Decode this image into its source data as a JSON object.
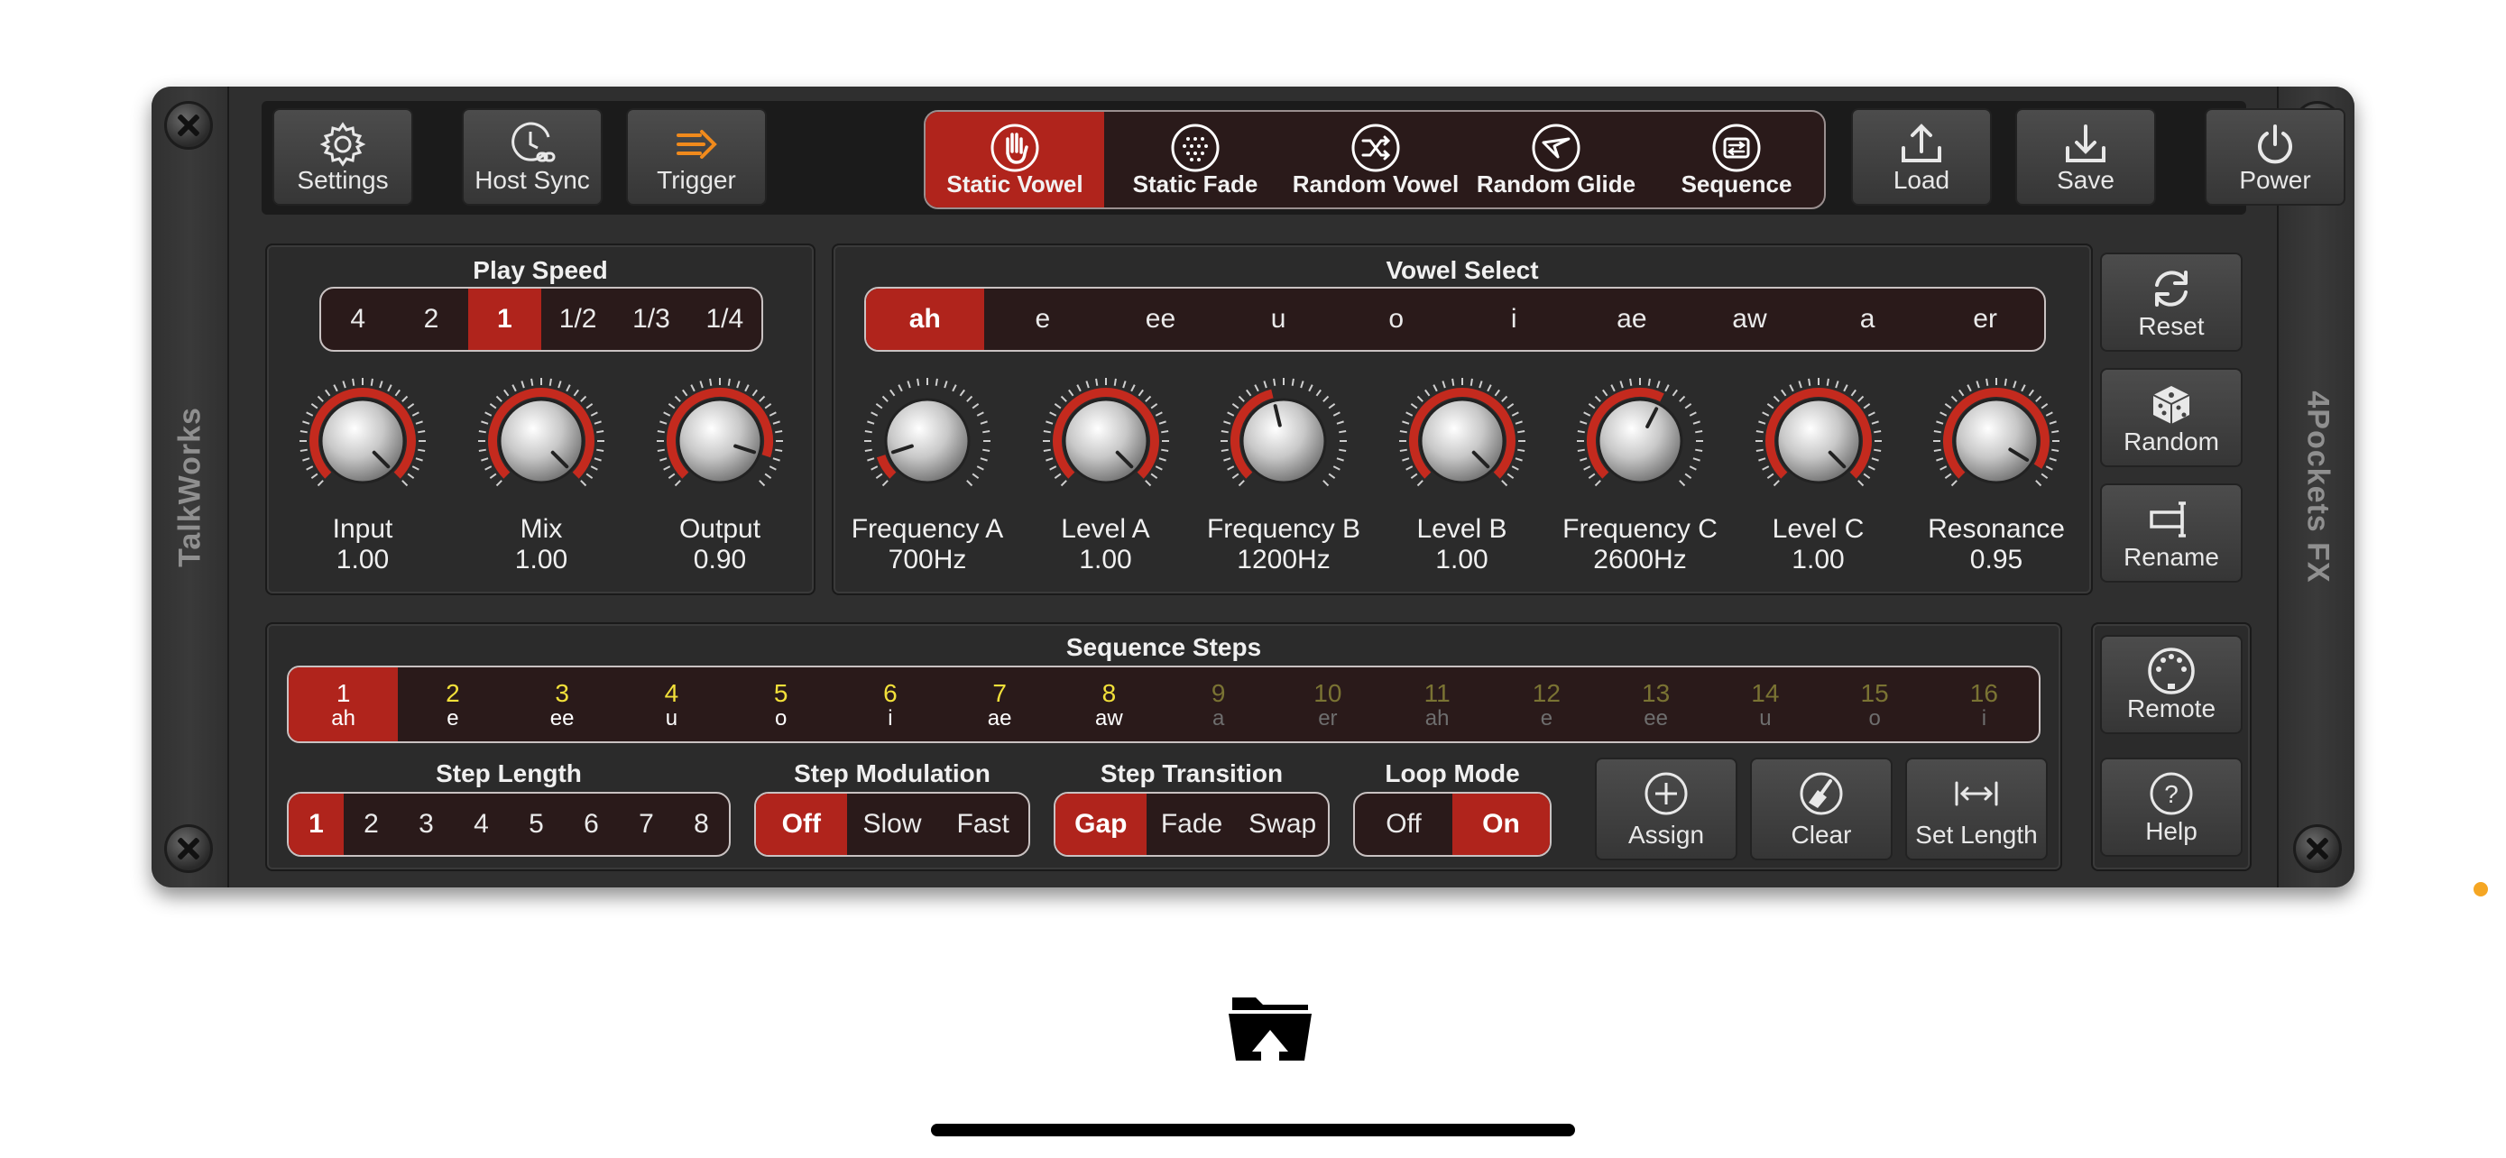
{
  "brand_left": "TalkWorks",
  "brand_right": "4Pockets FX",
  "topbar": {
    "settings": "Settings",
    "host_sync": "Host Sync",
    "trigger": "Trigger",
    "modes": [
      "Static Vowel",
      "Static Fade",
      "Random Vowel",
      "Random Glide",
      "Sequence"
    ],
    "active_mode": 0,
    "load": "Load",
    "save": "Save",
    "power": "Power"
  },
  "play_speed": {
    "title": "Play Speed",
    "options": [
      "4",
      "2",
      "1",
      "1/2",
      "1/3",
      "1/4"
    ],
    "selected": 2,
    "knobs": [
      {
        "label": "Input",
        "value": "1.00",
        "level": 1.0
      },
      {
        "label": "Mix",
        "value": "1.00",
        "level": 1.0
      },
      {
        "label": "Output",
        "value": "0.90",
        "level": 0.9
      }
    ]
  },
  "vowel_select": {
    "title": "Vowel Select",
    "options": [
      "ah",
      "e",
      "ee",
      "u",
      "o",
      "i",
      "ae",
      "aw",
      "a",
      "er"
    ],
    "selected": 0,
    "knobs": [
      {
        "label": "Frequency A",
        "value": "700Hz",
        "level": 0.1
      },
      {
        "label": "Level A",
        "value": "1.00",
        "level": 1.0
      },
      {
        "label": "Frequency B",
        "value": "1200Hz",
        "level": 0.45
      },
      {
        "label": "Level B",
        "value": "1.00",
        "level": 1.0
      },
      {
        "label": "Frequency C",
        "value": "2600Hz",
        "level": 0.6
      },
      {
        "label": "Level C",
        "value": "1.00",
        "level": 1.0
      },
      {
        "label": "Resonance",
        "value": "0.95",
        "level": 0.95
      }
    ]
  },
  "side_buttons": {
    "reset": "Reset",
    "random": "Random",
    "rename": "Rename",
    "remote": "Remote",
    "help": "Help"
  },
  "sequence": {
    "title": "Sequence Steps",
    "steps": [
      {
        "n": "1",
        "v": "ah"
      },
      {
        "n": "2",
        "v": "e"
      },
      {
        "n": "3",
        "v": "ee"
      },
      {
        "n": "4",
        "v": "u"
      },
      {
        "n": "5",
        "v": "o"
      },
      {
        "n": "6",
        "v": "i"
      },
      {
        "n": "7",
        "v": "ae"
      },
      {
        "n": "8",
        "v": "aw"
      },
      {
        "n": "9",
        "v": "a"
      },
      {
        "n": "10",
        "v": "er"
      },
      {
        "n": "11",
        "v": "ah"
      },
      {
        "n": "12",
        "v": "e"
      },
      {
        "n": "13",
        "v": "ee"
      },
      {
        "n": "14",
        "v": "u"
      },
      {
        "n": "15",
        "v": "o"
      },
      {
        "n": "16",
        "v": "i"
      }
    ],
    "active_step": 0,
    "length": 8,
    "step_length": {
      "title": "Step Length",
      "options": [
        "1",
        "2",
        "3",
        "4",
        "5",
        "6",
        "7",
        "8"
      ],
      "selected": 0
    },
    "step_modulation": {
      "title": "Step Modulation",
      "options": [
        "Off",
        "Slow",
        "Fast"
      ],
      "selected": 0
    },
    "step_transition": {
      "title": "Step Transition",
      "options": [
        "Gap",
        "Fade",
        "Swap"
      ],
      "selected": 0
    },
    "loop_mode": {
      "title": "Loop Mode",
      "options": [
        "Off",
        "On"
      ],
      "selected": 1
    },
    "assign": "Assign",
    "clear": "Clear",
    "set_length": "Set Length"
  },
  "colors": {
    "accent": "#b0241c",
    "step_used": "#f2e03a",
    "dot": "#f5a623"
  }
}
